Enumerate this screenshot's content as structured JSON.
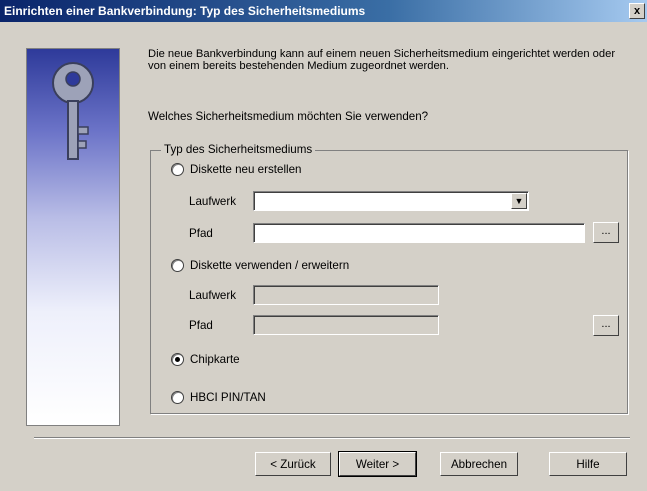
{
  "window": {
    "title": "Einrichten einer Bankverbindung: Typ des Sicherheitsmediums",
    "close_label": "x"
  },
  "intro_text": "Die neue Bankverbindung kann  auf einem neuen Sicherheitsmedium eingerichtet werden oder von einem bereits bestehenden Medium zugeordnet werden.",
  "question_text": "Welches Sicherheitsmedium möchten Sie verwenden?",
  "group": {
    "legend": "Typ des Sicherheitsmediums",
    "options": [
      {
        "label": "Diskette neu erstellen",
        "checked": false
      },
      {
        "label": "Diskette verwenden / erweitern",
        "checked": false
      },
      {
        "label": "Chipkarte",
        "checked": true
      },
      {
        "label": "HBCI PIN/TAN",
        "checked": false
      }
    ],
    "new_disk": {
      "drive_label": "Laufwerk",
      "drive_value": "",
      "path_label": "Pfad",
      "path_value": "",
      "browse_label": "..."
    },
    "existing_disk": {
      "drive_label": "Laufwerk",
      "drive_value": "",
      "path_label": "Pfad",
      "path_value": "",
      "browse_label": "..."
    }
  },
  "buttons": {
    "back": "< Zurück",
    "next": "Weiter >",
    "cancel": "Abbrechen",
    "help": "Hilfe"
  },
  "icons": {
    "key": "key-icon",
    "dropdown": "chevron-down-icon"
  },
  "colors": {
    "titlebar_start": "#0a246a",
    "titlebar_end": "#a6caf0",
    "face": "#d4d0c8"
  }
}
